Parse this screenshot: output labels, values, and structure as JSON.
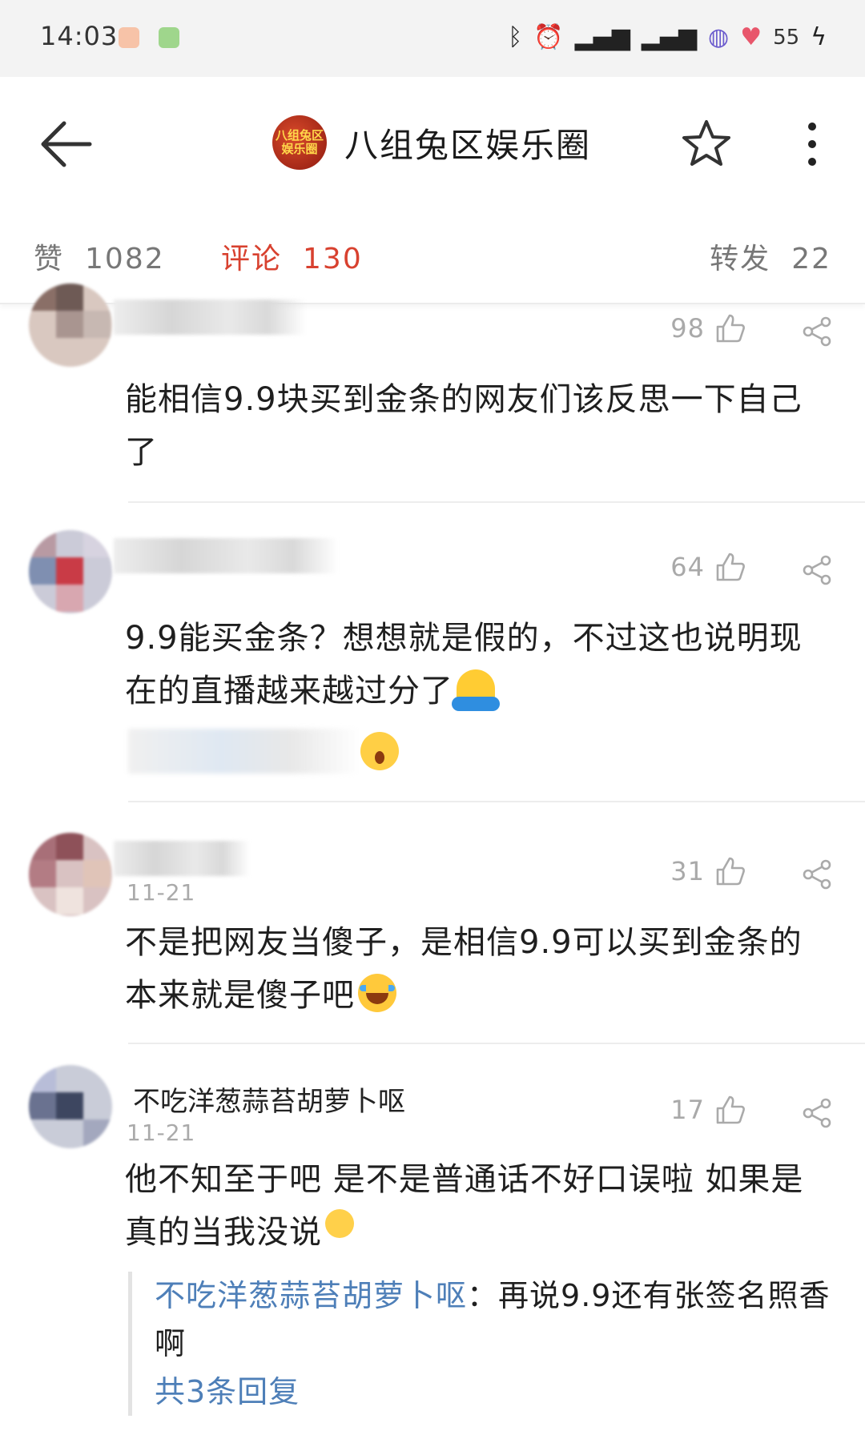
{
  "status_bar": {
    "time": "14:03",
    "battery": "55",
    "icons": [
      "bluetooth-icon",
      "alarm-icon",
      "signal-icon",
      "signal-icon",
      "planet-icon",
      "heart-icon",
      "charging-icon"
    ]
  },
  "header": {
    "title": "八组兔区娱乐圈",
    "avatar_text_line1": "八组兔区",
    "avatar_text_line2": "娱乐圈"
  },
  "stats": {
    "likes_label": "赞",
    "likes_count": "1082",
    "comments_label": "评论",
    "comments_count": "130",
    "reposts_label": "转发",
    "reposts_count": "22"
  },
  "comments": [
    {
      "date": "",
      "likes": "98",
      "text": "能相信9.9块买到金条的网友们该反思一下自己了"
    },
    {
      "date": "",
      "likes": "64",
      "text": "9.9能买金条？想想就是假的，不过这也说明现在的直播越来越过分了"
    },
    {
      "date": "11-21",
      "likes": "31",
      "text": "不是把网友当傻子，是相信9.9可以买到金条的本来就是傻子吧"
    },
    {
      "name": "不吃洋葱蒜苔胡萝卜呕",
      "date": "11-21",
      "likes": "17",
      "text": "他不知至于吧 是不是普通话不好口误啦 如果是真的当我没说",
      "reply_author": "不吃洋葱蒜苔胡萝卜呕",
      "reply_sep": "：",
      "reply_text": "再说9.9还有张签名照香啊",
      "reply_more": "共3条回复"
    }
  ],
  "colors": {
    "accent": "#d8412f",
    "link": "#4e7fb8",
    "muted": "#a9a9a9"
  }
}
